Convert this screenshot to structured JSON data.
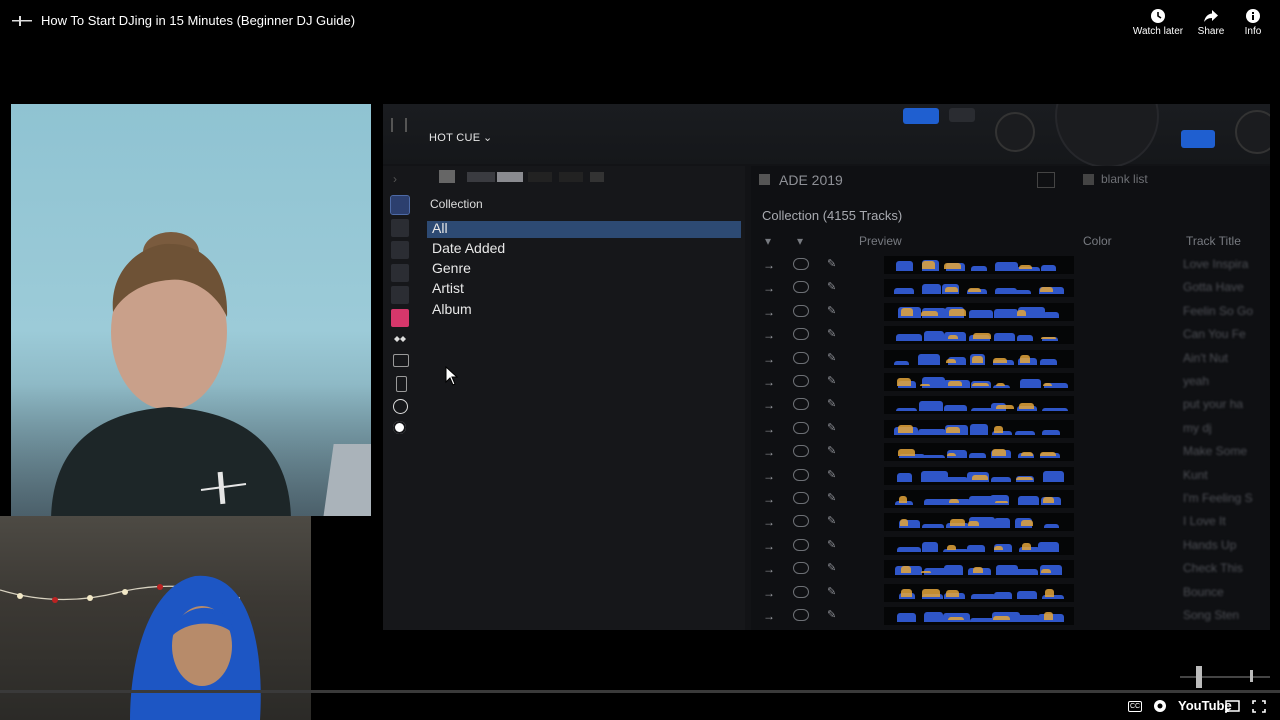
{
  "video": {
    "title": "How To Start DJing in 15 Minutes (Beginner DJ Guide)"
  },
  "top_actions": [
    {
      "label": "Watch later",
      "icon": "clock-icon"
    },
    {
      "label": "Share",
      "icon": "share-arrow-icon"
    },
    {
      "label": "Info",
      "icon": "info-icon"
    }
  ],
  "rekordbox": {
    "hot_cue_label": "HOT CUE",
    "collection_header": "Collection",
    "tree": [
      "All",
      "Date Added",
      "Genre",
      "Artist",
      "Album"
    ],
    "selected_tree_item": "All",
    "tab_label": "ADE 2019",
    "tab2_label": "blank list",
    "collection_count": "Collection (4155 Tracks)",
    "columns": [
      "Preview",
      "Color",
      "Track Title"
    ],
    "tracks": [
      "Love Inspira",
      "Gotta Have",
      "Feelin So Go",
      "Can You Fe",
      "Ain't Nut",
      "yeah",
      "put your ha",
      "my dj",
      "Make Some",
      "Kunt",
      "I'm Feeling S",
      "I Love It",
      "Hands Up",
      "Check This",
      "Bounce",
      "Song Sten"
    ]
  },
  "player": {
    "brand": "YouTube",
    "icons": [
      "closed-captions-icon",
      "settings-icon",
      "cast-icon",
      "fullscreen-icon"
    ]
  },
  "colors": {
    "accent_blue": "#1f5fd0",
    "selection_blue": "#2d4a73",
    "wave_blue": "#2f56c8",
    "wave_orange": "#e3a43a"
  }
}
